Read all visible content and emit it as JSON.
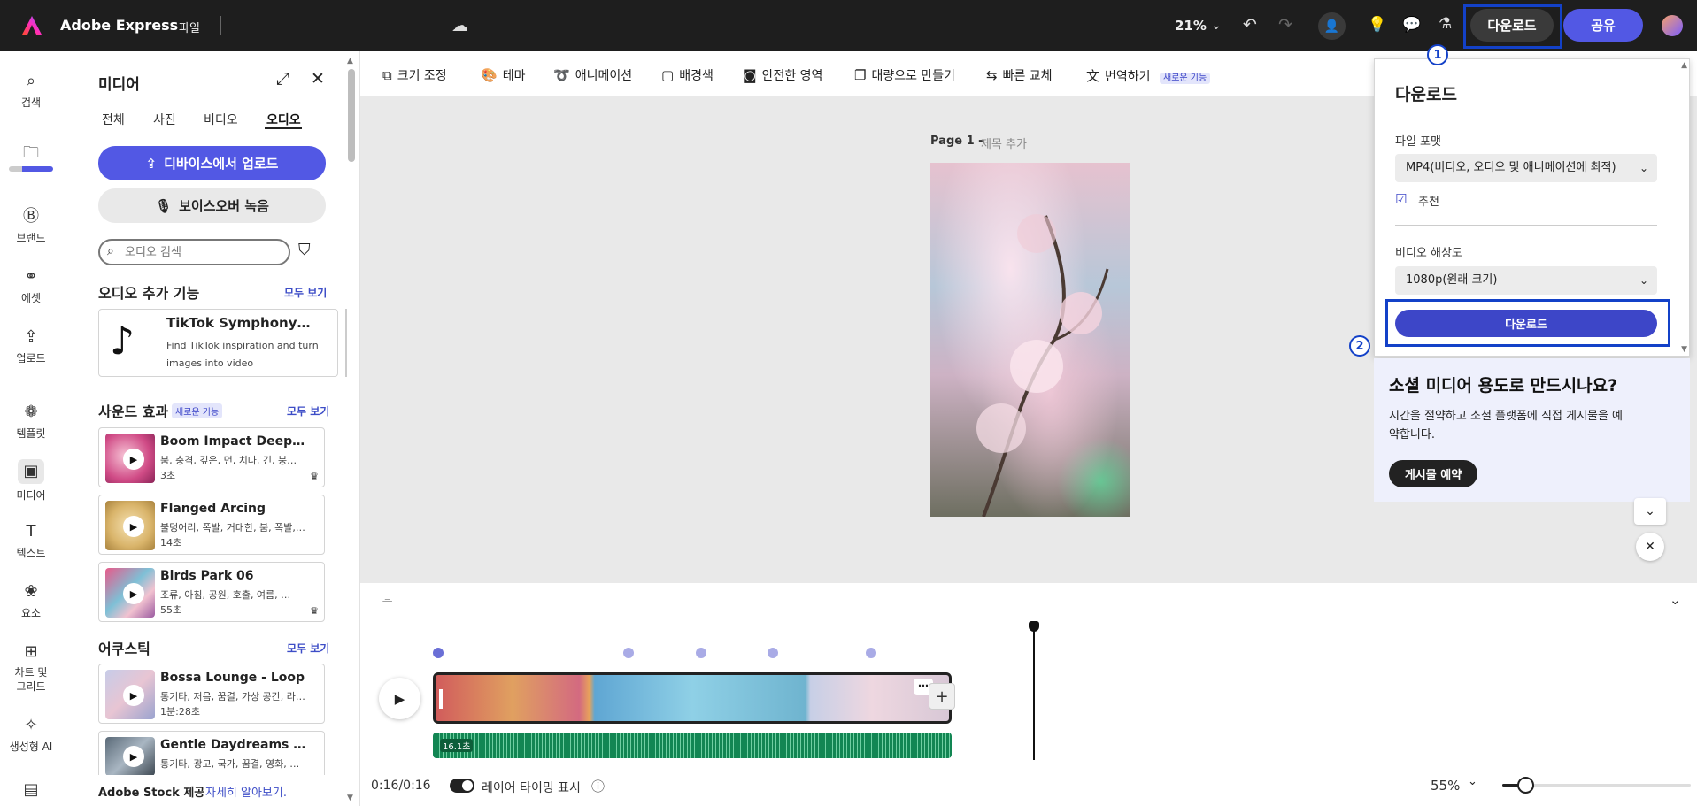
{
  "topbar": {
    "brand": "Adobe Express",
    "file_menu": "파일",
    "zoom": "21%",
    "download_label": "다운로드",
    "share_label": "공유"
  },
  "rail": {
    "items": [
      {
        "label": "검색"
      },
      {
        "label": ""
      },
      {
        "label": "브랜드"
      },
      {
        "label": "에셋"
      },
      {
        "label": "업로드"
      },
      {
        "label": "템플릿"
      },
      {
        "label": "미디어"
      },
      {
        "label": "텍스트"
      },
      {
        "label": "요소"
      },
      {
        "label": "차트 및 그리드"
      },
      {
        "label": "생성형 AI"
      }
    ]
  },
  "media_panel": {
    "title": "미디어",
    "tabs": [
      "전체",
      "사진",
      "비디오",
      "오디오"
    ],
    "active_tab": "오디오",
    "upload_button": "디바이스에서 업로드",
    "voiceover_button": "보이스오버 녹음",
    "search_placeholder": "오디오 검색",
    "addons_title": "오디오 추가 기능",
    "see_all": "모두 보기",
    "addon": {
      "title": "TikTok Symphony…",
      "desc": "Find TikTok inspiration and turn images into video"
    },
    "sfx_title": "사운드 효과",
    "new_badge": "새로운 기능",
    "sfx": [
      {
        "title": "Boom Impact Deep D…",
        "tags": "붐, 충격, 깊은, 먼, 치다, 긴, 붕…",
        "duration": "3초"
      },
      {
        "title": "Flanged Arcing",
        "tags": "불덩어리, 폭발, 거대한, 붐, 폭발,…",
        "duration": "14초"
      },
      {
        "title": "Birds Park 06",
        "tags": "조류, 아침, 공원, 호출, 여름, …",
        "duration": "55초"
      }
    ],
    "acoustic_title": "어쿠스틱",
    "acoustic": [
      {
        "title": "Bossa Lounge - Loop",
        "tags": "통기타, 저음, 꿈결, 가상 공간, 라…",
        "duration": "1분:28초"
      },
      {
        "title": "Gentle Daydreams - Lo…",
        "tags": "통기타, 광고, 국가, 꿈결, 영화, …",
        "duration": ""
      }
    ],
    "footer_text": "Adobe Stock 제공",
    "footer_link": "자세히 알아보기."
  },
  "toolbar": {
    "items": [
      "크기 조정",
      "테마",
      "애니메이션",
      "배경색",
      "안전한 영역",
      "대량으로 만들기",
      "빠른 교체",
      "번역하기"
    ],
    "translate_badge": "새로운 기능"
  },
  "canvas": {
    "page_label": "Page 1 -",
    "page_title_placeholder": "제목 추가"
  },
  "download_panel": {
    "title": "다운로드",
    "format_label": "파일 포맷",
    "format_value": "MP4(비디오, 오디오 및 애니메이션에 최적)",
    "recommended": "추천",
    "resolution_label": "비디오 해상도",
    "resolution_value": "1080p(원래 크기)",
    "download_button": "다운로드"
  },
  "promo": {
    "title": "소셜 미디어 용도로 만드시나요?",
    "body": "시간을 절약하고 소셜 플랫폼에 직접 게시물을 예약합니다.",
    "button": "게시물 예약"
  },
  "timeline": {
    "time": "0:16/0:16",
    "layer_timing_label": "레이어 타이밍 표시",
    "audio_duration": "16.1초",
    "zoom": "55%",
    "zoom_level": 0.12
  },
  "annotations": [
    "1",
    "2"
  ],
  "colors": {
    "accent": "#5258e4",
    "download_primary": "#3d46c8",
    "annotation": "#1341c8",
    "audio_track": "#128653",
    "topbar": "#1e1e1e"
  }
}
